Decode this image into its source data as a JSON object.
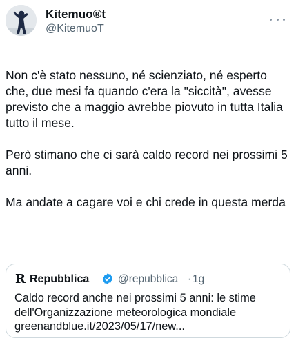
{
  "author": {
    "display_name": "Kitemuo®t",
    "handle": "@KitemuoT",
    "avatar_icon": "figure-silhouette-avatar-icon"
  },
  "menu": {
    "more_icon": "more-options-icon"
  },
  "tweet": {
    "paragraph_1": "Non c'è stato nessuno, né scienziato, né esperto che, due mesi fa quando c'era la \"siccità\", avesse previsto che a maggio avrebbe piovuto in tutta Italia tutto il mese.",
    "paragraph_2": "Però stimano che ci sarà caldo record nei prossimi 5 anni.",
    "paragraph_3": "Ma andate a cagare voi e chi crede in questa merda"
  },
  "quoted": {
    "logo_letter": "R",
    "display_name": "Repubblica",
    "verified_icon": "verified-badge-icon",
    "badge_color": "#1d9bf0",
    "handle": "@repubblica",
    "separator": "·",
    "time": "1g",
    "text": "Caldo record anche nei prossimi 5 anni: le stime dell'Organizzazione meteorologica mondiale greenandblue.it/2023/05/17/new..."
  },
  "colors": {
    "text": "#0f1419",
    "secondary": "#536471",
    "border": "#cfd9de"
  }
}
